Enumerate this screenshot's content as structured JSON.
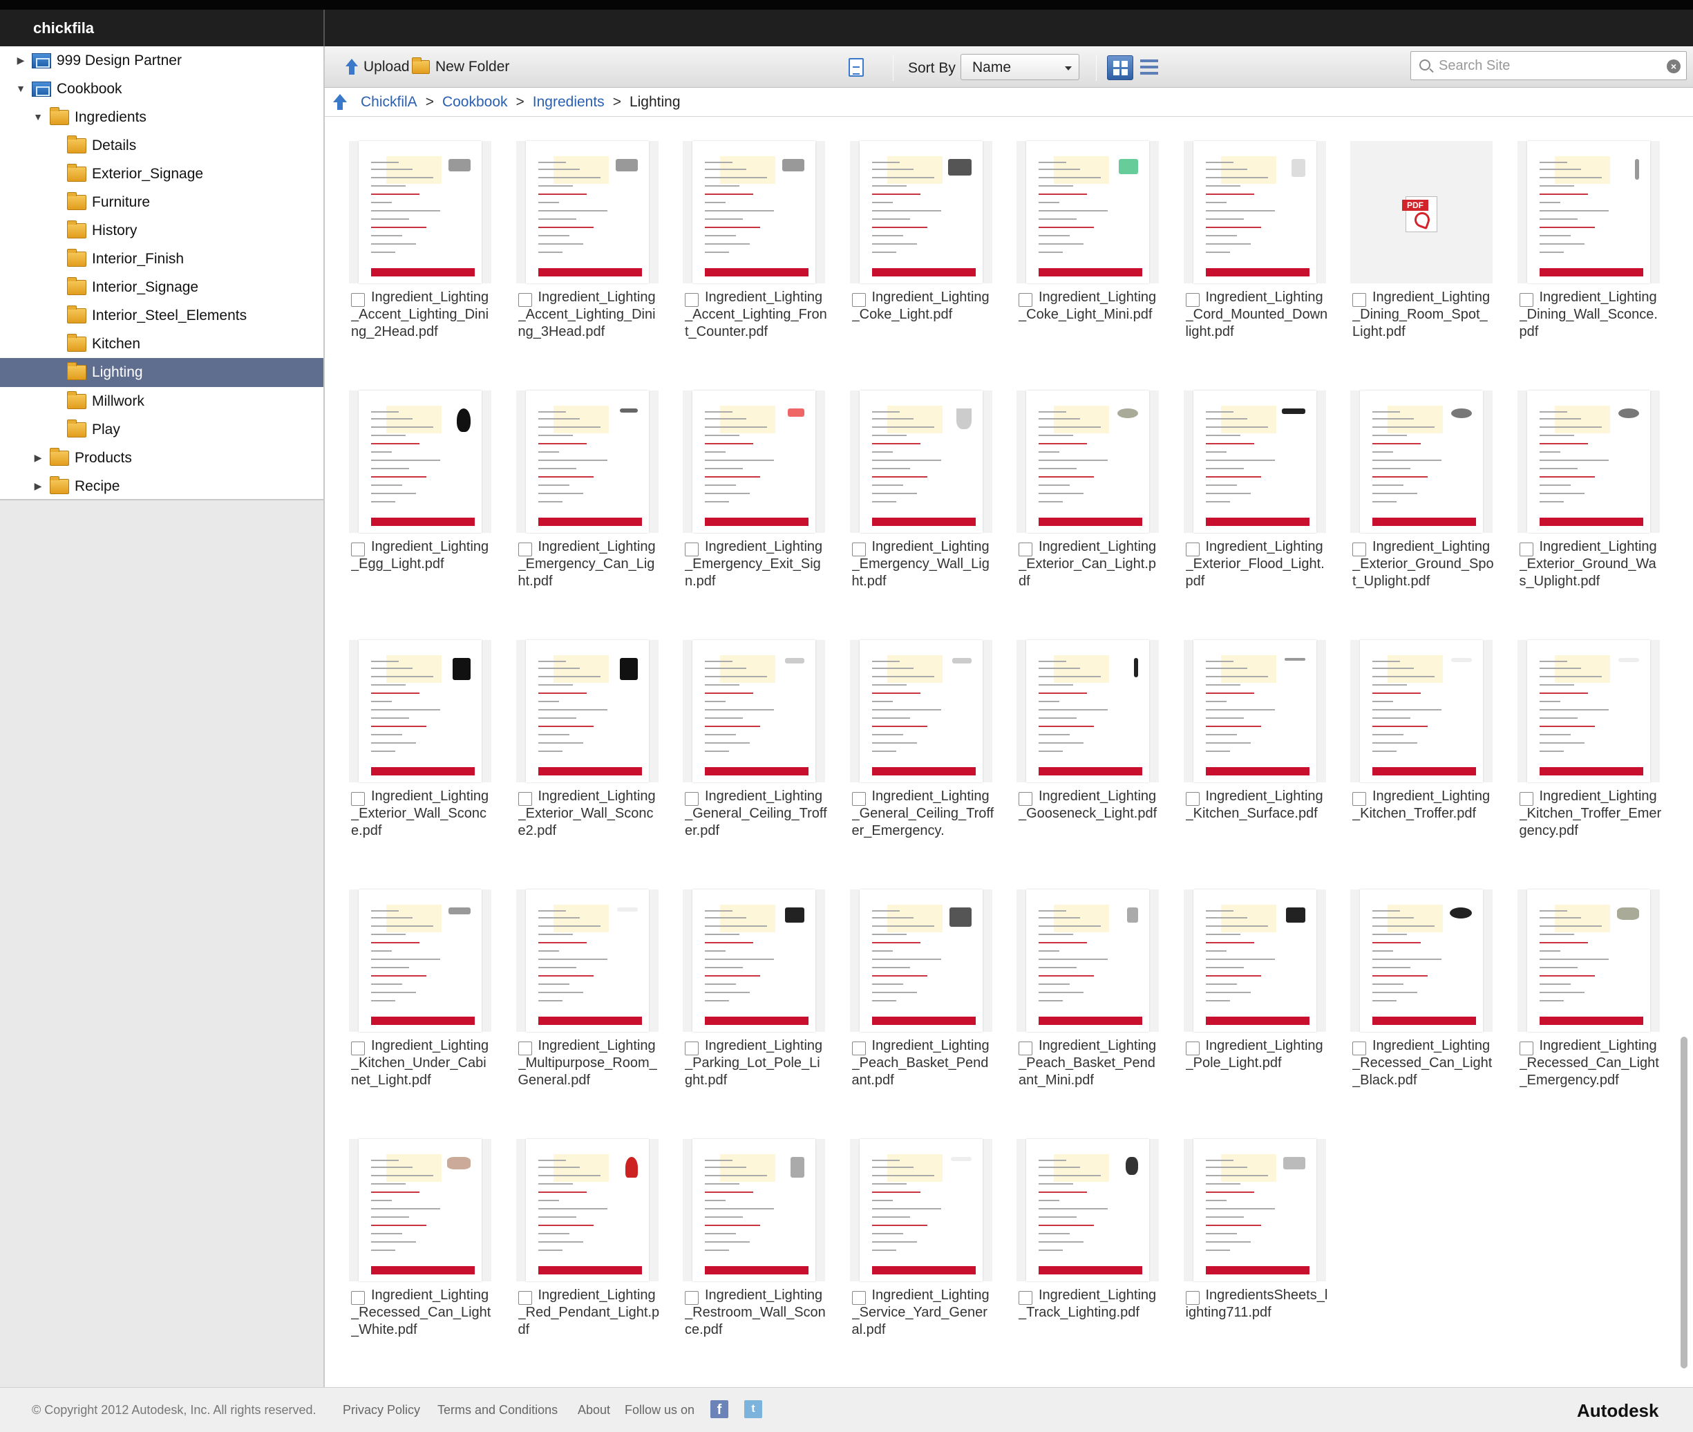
{
  "app": {
    "brand": "chickfila"
  },
  "sidebar": {
    "items": [
      {
        "label": "999 Design Partner",
        "level": 0,
        "icon": "cabinet-icon",
        "expander": "collapsed"
      },
      {
        "label": "Cookbook",
        "level": 0,
        "icon": "cabinet-icon",
        "expander": "expanded"
      },
      {
        "label": "Ingredients",
        "level": 1,
        "icon": "folder-icon",
        "expander": "expanded"
      },
      {
        "label": "Details",
        "level": 2,
        "icon": "folder-icon",
        "expander": "none"
      },
      {
        "label": "Exterior_Signage",
        "level": 2,
        "icon": "folder-icon",
        "expander": "none"
      },
      {
        "label": "Furniture",
        "level": 2,
        "icon": "folder-icon",
        "expander": "none"
      },
      {
        "label": "History",
        "level": 2,
        "icon": "folder-icon",
        "expander": "none"
      },
      {
        "label": "Interior_Finish",
        "level": 2,
        "icon": "folder-icon",
        "expander": "none"
      },
      {
        "label": "Interior_Signage",
        "level": 2,
        "icon": "folder-icon",
        "expander": "none"
      },
      {
        "label": "Interior_Steel_Elements",
        "level": 2,
        "icon": "folder-icon",
        "expander": "none"
      },
      {
        "label": "Kitchen",
        "level": 2,
        "icon": "folder-icon",
        "expander": "none"
      },
      {
        "label": "Lighting",
        "level": 2,
        "icon": "folder-icon",
        "expander": "none",
        "selected": true
      },
      {
        "label": "Millwork",
        "level": 2,
        "icon": "folder-icon",
        "expander": "none"
      },
      {
        "label": "Play",
        "level": 2,
        "icon": "folder-icon",
        "expander": "none"
      },
      {
        "label": "Products",
        "level": 1,
        "icon": "folder-icon",
        "expander": "collapsed"
      },
      {
        "label": "Recipe",
        "level": 1,
        "icon": "folder-icon",
        "expander": "collapsed"
      }
    ]
  },
  "toolbar": {
    "upload_label": "Upload",
    "new_folder_label": "New Folder",
    "sort_by_label": "Sort By",
    "sort_value": "Name",
    "search_placeholder": "Search Site"
  },
  "breadcrumb": {
    "links": [
      "ChickfilA",
      "Cookbook",
      "Ingredients"
    ],
    "separator": ">",
    "current": "Lighting"
  },
  "files": [
    {
      "name": "Ingredient_Lighting_Accent_Lighting_Dining_2Head.pdf",
      "thumb": "page"
    },
    {
      "name": "Ingredient_Lighting_Accent_Lighting_Dining_3Head.pdf",
      "thumb": "page"
    },
    {
      "name": "Ingredient_Lighting_Accent_Lighting_Front_Counter.pdf",
      "thumb": "page"
    },
    {
      "name": "Ingredient_Lighting_Coke_Light.pdf",
      "thumb": "page"
    },
    {
      "name": "Ingredient_Lighting_Coke_Light_Mini.pdf",
      "thumb": "page"
    },
    {
      "name": "Ingredient_Lighting_Cord_Mounted_Downlight.pdf",
      "thumb": "page"
    },
    {
      "name": "Ingredient_Lighting_Dining_Room_Spot_Light.pdf",
      "thumb": "pdf-icon"
    },
    {
      "name": "Ingredient_Lighting_Dining_Wall_Sconce.pdf",
      "thumb": "page"
    },
    {
      "name": "Ingredient_Lighting_Egg_Light.pdf",
      "thumb": "page"
    },
    {
      "name": "Ingredient_Lighting_Emergency_Can_Light.pdf",
      "thumb": "page"
    },
    {
      "name": "Ingredient_Lighting_Emergency_Exit_Sign.pdf",
      "thumb": "page"
    },
    {
      "name": "Ingredient_Lighting_Emergency_Wall_Light.pdf",
      "thumb": "page"
    },
    {
      "name": "Ingredient_Lighting_Exterior_Can_Light.pdf",
      "thumb": "page"
    },
    {
      "name": "Ingredient_Lighting_Exterior_Flood_Light.pdf",
      "thumb": "page"
    },
    {
      "name": "Ingredient_Lighting_Exterior_Ground_Spot_Uplight.pdf",
      "thumb": "page"
    },
    {
      "name": "Ingredient_Lighting_Exterior_Ground_Was_Uplight.pdf",
      "thumb": "page"
    },
    {
      "name": "Ingredient_Lighting_Exterior_Wall_Sconce.pdf",
      "thumb": "page"
    },
    {
      "name": "Ingredient_Lighting_Exterior_Wall_Sconce2.pdf",
      "thumb": "page"
    },
    {
      "name": "Ingredient_Lighting_General_Ceiling_Troffer.pdf",
      "thumb": "page"
    },
    {
      "name": "Ingredient_Lighting_General_Ceiling_Troffer_Emergency.",
      "thumb": "page"
    },
    {
      "name": "Ingredient_Lighting_Gooseneck_Light.pdf",
      "thumb": "page"
    },
    {
      "name": "Ingredient_Lighting_Kitchen_Surface.pdf",
      "thumb": "page"
    },
    {
      "name": "Ingredient_Lighting_Kitchen_Troffer.pdf",
      "thumb": "page"
    },
    {
      "name": "Ingredient_Lighting_Kitchen_Troffer_Emergency.pdf",
      "thumb": "page"
    },
    {
      "name": "Ingredient_Lighting_Kitchen_Under_Cabinet_Light.pdf",
      "thumb": "page"
    },
    {
      "name": "Ingredient_Lighting_Multipurpose_Room_General.pdf",
      "thumb": "page"
    },
    {
      "name": "Ingredient_Lighting_Parking_Lot_Pole_Light.pdf",
      "thumb": "page"
    },
    {
      "name": "Ingredient_Lighting_Peach_Basket_Pendant.pdf",
      "thumb": "page"
    },
    {
      "name": "Ingredient_Lighting_Peach_Basket_Pendant_Mini.pdf",
      "thumb": "page"
    },
    {
      "name": "Ingredient_Lighting_Pole_Light.pdf",
      "thumb": "page"
    },
    {
      "name": "Ingredient_Lighting_Recessed_Can_Light_Black.pdf",
      "thumb": "page"
    },
    {
      "name": "Ingredient_Lighting_Recessed_Can_Light_Emergency.pdf",
      "thumb": "page"
    },
    {
      "name": "Ingredient_Lighting_Recessed_Can_Light_White.pdf",
      "thumb": "page"
    },
    {
      "name": "Ingredient_Lighting_Red_Pendant_Light.pdf",
      "thumb": "page"
    },
    {
      "name": "Ingredient_Lighting_Restroom_Wall_Sconce.pdf",
      "thumb": "page"
    },
    {
      "name": "Ingredient_Lighting_Service_Yard_General.pdf",
      "thumb": "page"
    },
    {
      "name": "Ingredient_Lighting_Track_Lighting.pdf",
      "thumb": "page"
    },
    {
      "name": "IngredientsSheets_lighting711.pdf",
      "thumb": "page"
    }
  ],
  "footer": {
    "copyright": "© Copyright 2012 Autodesk, Inc. All rights reserved.",
    "links": [
      "Privacy Policy",
      "Terms and Conditions",
      "About"
    ],
    "follow_label": "Follow us on",
    "logo_text": "Autodesk"
  },
  "colors": {
    "accent": "#3a79c9",
    "selected_row": "#5f6e8f",
    "pdf_red": "#c8102e"
  }
}
